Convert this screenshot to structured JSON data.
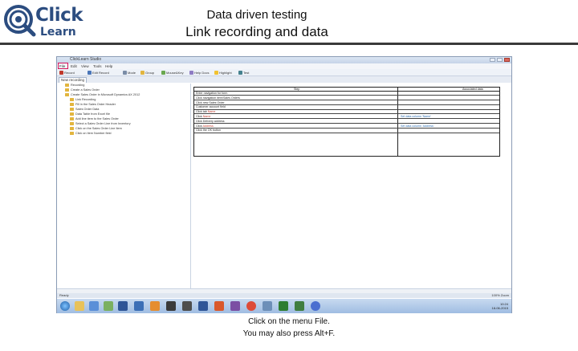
{
  "logo": {
    "word1": "Click",
    "word2": "Learn"
  },
  "slide": {
    "title": "Data driven testing",
    "subtitle": "Link recording and data"
  },
  "app": {
    "window_title": "ClickLearn Studio",
    "menu": [
      "File",
      "Edit",
      "View",
      "Tools",
      "Help"
    ],
    "toolbar": [
      "Record",
      "Edit Record",
      "Mode",
      "Group",
      "Mouse&Key",
      "Help Docs",
      "Highlight",
      "Test"
    ],
    "tab": "New recording",
    "tree": [
      "Recording",
      "Create a Sales Order",
      "Create Sales Order in Microsoft Dynamics AX 2012",
      "Link Recording",
      "Fill in the Sales Order Header",
      "Sales Order Data",
      "Data Table from Excel file",
      "Add line item to the Sales Order",
      "Select a Sales Order Line from Inventory",
      "Click on the Sales Order Line Item",
      "Click on Item Number field"
    ],
    "steps_header": {
      "step": "Step",
      "data": "Associated data"
    },
    "steps": [
      {
        "text": "Enter navigation for form",
        "data": ""
      },
      {
        "text": "Click navigation item/Sales Orders ",
        "data": ""
      },
      {
        "text": "Click new Sales Order",
        "data": ""
      },
      {
        "text": "Customer account field",
        "data": ""
      },
      {
        "text": "Click tab ",
        "accent": "Name",
        "data": ""
      },
      {
        "text": "Click ",
        "accent": "Name",
        "data": "Set data column 'Name'"
      },
      {
        "text": "Click Delivery address",
        "data": ""
      },
      {
        "text": "Click ",
        "accent": "Address",
        "data": "Set data column 'Address'"
      },
      {
        "text": "Click the OK button",
        "data": ""
      }
    ],
    "status_left": "Ready",
    "status_right": "100%  Zoom",
    "tray_time": "10:24",
    "tray_date": "18-06-2015"
  },
  "caption": {
    "line1": "Click on the menu File.",
    "line2": "You may also press Alt+F."
  }
}
